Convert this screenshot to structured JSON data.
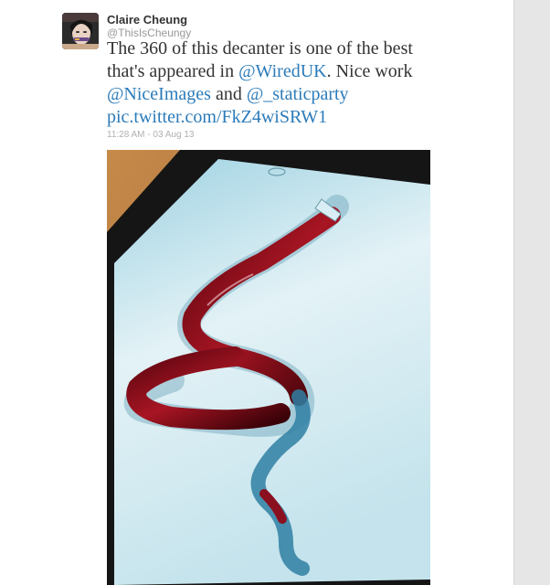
{
  "tweet": {
    "author": {
      "name": "Claire Cheung",
      "handle": "@ThisIsCheungy"
    },
    "text_parts": {
      "intro": "The 360 of this decanter is one of the best that's appeared in ",
      "mention_wired": "@WiredUK",
      "middle": ". Nice work ",
      "mention_niceimages": "@NiceImages",
      "and": " and ",
      "mention_staticparty": "@_staticparty",
      "pic_link": "pic.twitter.com/FkZ4wiSRW1"
    },
    "timestamp": "11:28 AM - 03 Aug 13",
    "media_alt": "Photo of a tablet showing a spiral glass decanter filled with red wine"
  },
  "colors": {
    "link": "#2b7bb9",
    "text": "#333333",
    "muted": "#999999",
    "wine": "#8a0f1c",
    "table_wood": "#b97a3d"
  }
}
